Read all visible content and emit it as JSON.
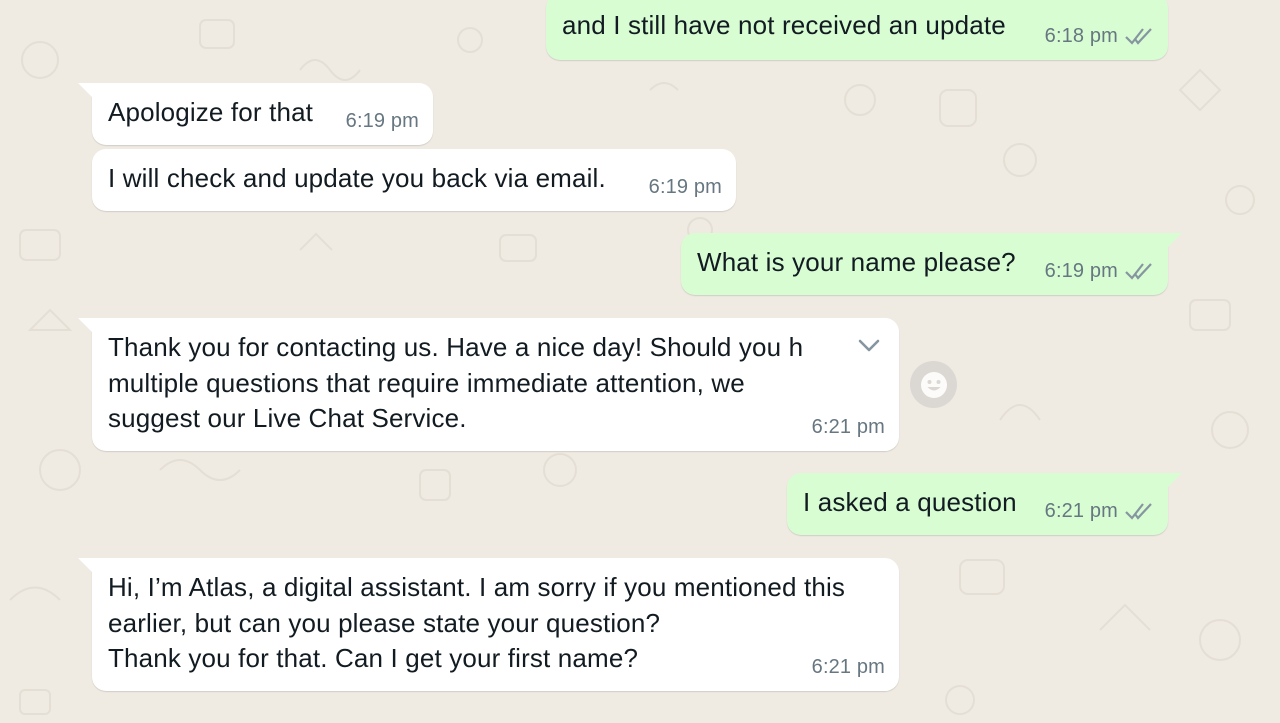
{
  "messages": [
    {
      "text": "and I still have not received an update",
      "time": "6:18 pm"
    },
    {
      "text": "Apologize for that",
      "time": "6:19 pm"
    },
    {
      "text": "I will check and update you back via email.",
      "time": "6:19 pm"
    },
    {
      "text": "What is your name please?",
      "time": "6:19 pm"
    },
    {
      "lines": [
        "Thank you for contacting us. Have a nice day! Should you h",
        "multiple questions that require immediate attention, we",
        "suggest our Live Chat Service."
      ],
      "time": "6:21 pm"
    },
    {
      "text": "I asked a question",
      "time": "6:21 pm"
    },
    {
      "lines": [
        "Hi, I’m Atlas, a digital assistant. I am sorry if you mentioned this",
        "earlier, but can you please state your question?",
        "Thank you for that.  Can I get your first name?"
      ],
      "time": "6:21 pm"
    }
  ],
  "icons": {
    "read_receipt": "double-check-icon",
    "message_menu": "chevron-down-icon",
    "react": "smiley-icon"
  },
  "colors": {
    "wallpaper": "#efeae2",
    "incoming_bubble": "#ffffff",
    "outgoing_bubble": "#d9fdd3",
    "timestamp": "#667781",
    "read_tick": "#8696a0"
  }
}
